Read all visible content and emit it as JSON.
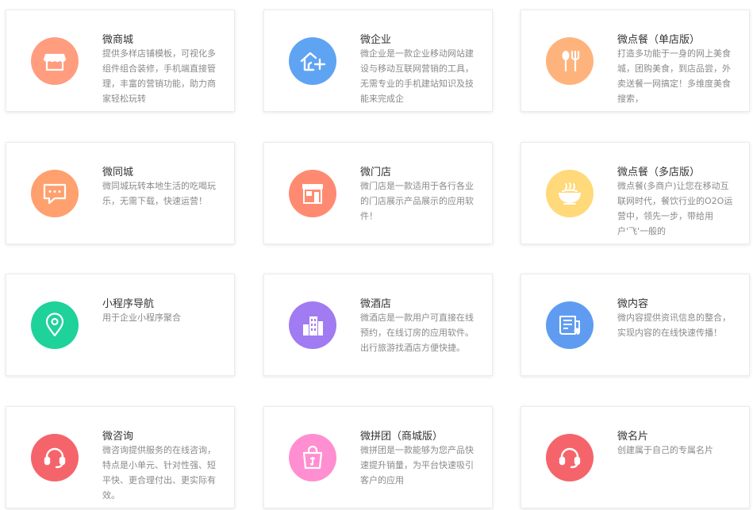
{
  "cards": [
    {
      "title": "微商城",
      "desc": "提供多样店铺模板，可视化多组件组合装修，手机端直接管理，丰富的营销功能，助力商家轻松玩转",
      "icon": "storefront-icon",
      "color": "#ff9d7e"
    },
    {
      "title": "微企业",
      "desc": "微企业是一款企业移动网站建设与移动互联网营销的工具，无需专业的手机建站知识及技能来完成企",
      "icon": "house-plus-icon",
      "color": "#5fa3f3"
    },
    {
      "title": "微点餐（单店版）",
      "desc": "打造多功能于一身的网上美食城，团购美食，到店品尝，外卖送餐一网搞定！多维度美食搜索，",
      "icon": "spoon-fork-icon",
      "color": "#ffb37c"
    },
    {
      "title": "微同城",
      "desc": "微同城玩转本地生活的吃喝玩乐，无需下载，快速运营！",
      "icon": "chat-bubble-icon",
      "color": "#ffa06f"
    },
    {
      "title": "微门店",
      "desc": "微门店是一款适用于各行各业的门店展示产品展示的应用软件！",
      "icon": "shop-door-icon",
      "color": "#ff8a72"
    },
    {
      "title": "微点餐（多店版）",
      "desc": "微点餐(多商户)让您在移动互联网时代，餐饮行业的O2O运营中，领先一步，带给用户'飞'一般的",
      "icon": "noodle-bowl-icon",
      "color": "#ffd97a"
    },
    {
      "title": "小程序导航",
      "desc": "用于企业小程序聚合",
      "icon": "map-pin-icon",
      "color": "#1ed29a"
    },
    {
      "title": "微酒店",
      "desc": "微酒店是一款用户可直接在线预约，在线订房的应用软件。出行旅游找酒店方便快捷。",
      "icon": "buildings-icon",
      "color": "#a07bf1"
    },
    {
      "title": "微内容",
      "desc": "微内容提供资讯信息的整合，实现内容的在线快速传播！",
      "icon": "newspaper-icon",
      "color": "#5f9cf1"
    },
    {
      "title": "微咨询",
      "desc": "微咨询提供服务的在线咨询，特点是小单元、针对性强、短平快、更合理付出、更实际有效。",
      "icon": "headset-icon",
      "color": "#f5646a"
    },
    {
      "title": "微拼团（商城版）",
      "desc": "微拼团是一款能够为您产品快速提升销量，为平台快速吸引客户的应用",
      "icon": "shopping-bag-icon",
      "color": "#ff8fd0"
    },
    {
      "title": "微名片",
      "desc": "创建属于自己的专属名片",
      "icon": "headset-icon",
      "color": "#f5646a"
    }
  ]
}
